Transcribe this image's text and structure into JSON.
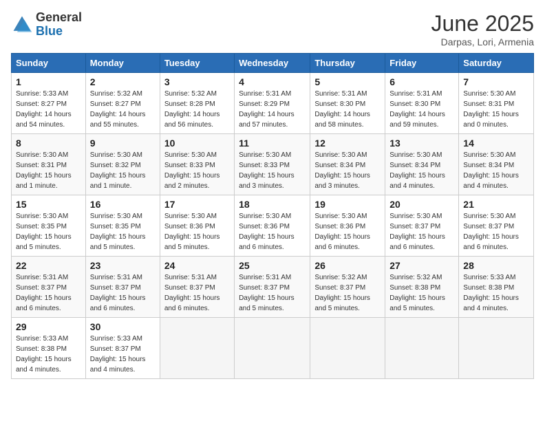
{
  "header": {
    "logo_general": "General",
    "logo_blue": "Blue",
    "month_year": "June 2025",
    "location": "Darpas, Lori, Armenia"
  },
  "days_of_week": [
    "Sunday",
    "Monday",
    "Tuesday",
    "Wednesday",
    "Thursday",
    "Friday",
    "Saturday"
  ],
  "weeks": [
    [
      {
        "day": "1",
        "info": "Sunrise: 5:33 AM\nSunset: 8:27 PM\nDaylight: 14 hours\nand 54 minutes."
      },
      {
        "day": "2",
        "info": "Sunrise: 5:32 AM\nSunset: 8:27 PM\nDaylight: 14 hours\nand 55 minutes."
      },
      {
        "day": "3",
        "info": "Sunrise: 5:32 AM\nSunset: 8:28 PM\nDaylight: 14 hours\nand 56 minutes."
      },
      {
        "day": "4",
        "info": "Sunrise: 5:31 AM\nSunset: 8:29 PM\nDaylight: 14 hours\nand 57 minutes."
      },
      {
        "day": "5",
        "info": "Sunrise: 5:31 AM\nSunset: 8:30 PM\nDaylight: 14 hours\nand 58 minutes."
      },
      {
        "day": "6",
        "info": "Sunrise: 5:31 AM\nSunset: 8:30 PM\nDaylight: 14 hours\nand 59 minutes."
      },
      {
        "day": "7",
        "info": "Sunrise: 5:30 AM\nSunset: 8:31 PM\nDaylight: 15 hours\nand 0 minutes."
      }
    ],
    [
      {
        "day": "8",
        "info": "Sunrise: 5:30 AM\nSunset: 8:31 PM\nDaylight: 15 hours\nand 1 minute."
      },
      {
        "day": "9",
        "info": "Sunrise: 5:30 AM\nSunset: 8:32 PM\nDaylight: 15 hours\nand 1 minute."
      },
      {
        "day": "10",
        "info": "Sunrise: 5:30 AM\nSunset: 8:33 PM\nDaylight: 15 hours\nand 2 minutes."
      },
      {
        "day": "11",
        "info": "Sunrise: 5:30 AM\nSunset: 8:33 PM\nDaylight: 15 hours\nand 3 minutes."
      },
      {
        "day": "12",
        "info": "Sunrise: 5:30 AM\nSunset: 8:34 PM\nDaylight: 15 hours\nand 3 minutes."
      },
      {
        "day": "13",
        "info": "Sunrise: 5:30 AM\nSunset: 8:34 PM\nDaylight: 15 hours\nand 4 minutes."
      },
      {
        "day": "14",
        "info": "Sunrise: 5:30 AM\nSunset: 8:34 PM\nDaylight: 15 hours\nand 4 minutes."
      }
    ],
    [
      {
        "day": "15",
        "info": "Sunrise: 5:30 AM\nSunset: 8:35 PM\nDaylight: 15 hours\nand 5 minutes."
      },
      {
        "day": "16",
        "info": "Sunrise: 5:30 AM\nSunset: 8:35 PM\nDaylight: 15 hours\nand 5 minutes."
      },
      {
        "day": "17",
        "info": "Sunrise: 5:30 AM\nSunset: 8:36 PM\nDaylight: 15 hours\nand 5 minutes."
      },
      {
        "day": "18",
        "info": "Sunrise: 5:30 AM\nSunset: 8:36 PM\nDaylight: 15 hours\nand 6 minutes."
      },
      {
        "day": "19",
        "info": "Sunrise: 5:30 AM\nSunset: 8:36 PM\nDaylight: 15 hours\nand 6 minutes."
      },
      {
        "day": "20",
        "info": "Sunrise: 5:30 AM\nSunset: 8:37 PM\nDaylight: 15 hours\nand 6 minutes."
      },
      {
        "day": "21",
        "info": "Sunrise: 5:30 AM\nSunset: 8:37 PM\nDaylight: 15 hours\nand 6 minutes."
      }
    ],
    [
      {
        "day": "22",
        "info": "Sunrise: 5:31 AM\nSunset: 8:37 PM\nDaylight: 15 hours\nand 6 minutes."
      },
      {
        "day": "23",
        "info": "Sunrise: 5:31 AM\nSunset: 8:37 PM\nDaylight: 15 hours\nand 6 minutes."
      },
      {
        "day": "24",
        "info": "Sunrise: 5:31 AM\nSunset: 8:37 PM\nDaylight: 15 hours\nand 6 minutes."
      },
      {
        "day": "25",
        "info": "Sunrise: 5:31 AM\nSunset: 8:37 PM\nDaylight: 15 hours\nand 5 minutes."
      },
      {
        "day": "26",
        "info": "Sunrise: 5:32 AM\nSunset: 8:37 PM\nDaylight: 15 hours\nand 5 minutes."
      },
      {
        "day": "27",
        "info": "Sunrise: 5:32 AM\nSunset: 8:38 PM\nDaylight: 15 hours\nand 5 minutes."
      },
      {
        "day": "28",
        "info": "Sunrise: 5:33 AM\nSunset: 8:38 PM\nDaylight: 15 hours\nand 4 minutes."
      }
    ],
    [
      {
        "day": "29",
        "info": "Sunrise: 5:33 AM\nSunset: 8:38 PM\nDaylight: 15 hours\nand 4 minutes."
      },
      {
        "day": "30",
        "info": "Sunrise: 5:33 AM\nSunset: 8:37 PM\nDaylight: 15 hours\nand 4 minutes."
      },
      null,
      null,
      null,
      null,
      null
    ]
  ]
}
